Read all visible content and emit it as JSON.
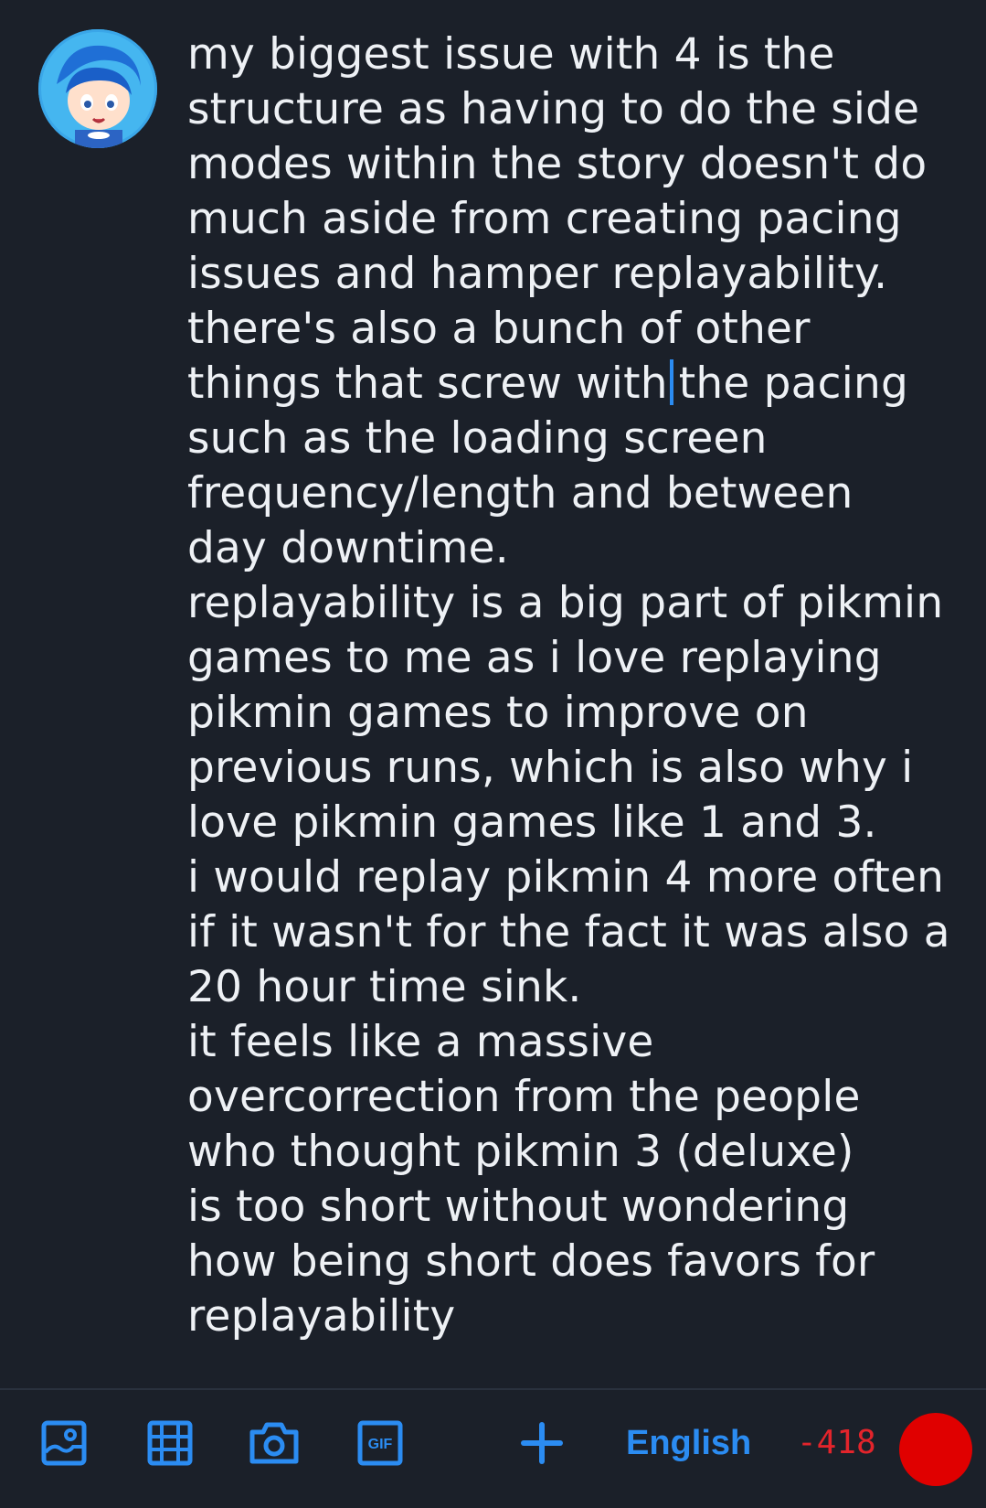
{
  "post": {
    "lines": [
      "my biggest issue with 4 is the",
      "structure as having to do the side",
      "modes within the story doesn't do",
      "much aside from creating pacing",
      "issues and hamper replayability.",
      "there's also a bunch of other",
      "things that screw with",
      "the pacing",
      "such as the loading screen",
      "frequency/length and between",
      "day downtime.",
      "replayability is a big part of pikmin",
      "games to me as i love replaying",
      "pikmin games to improve on",
      "previous runs, which is also why i",
      "love pikmin games like 1 and 3.",
      "i would replay pikmin 4 more often",
      "if it wasn't for the fact it was also a",
      "20 hour time sink.",
      "it feels like a massive",
      "overcorrection from the people",
      "who thought pikmin 3 (deluxe)",
      "is too short without wondering",
      "how being short does favors for",
      "replayability"
    ]
  },
  "toolbar": {
    "icons": [
      "image-icon",
      "video-icon",
      "camera-icon",
      "gif-icon",
      "plus-icon"
    ],
    "gif_text": "GIF",
    "language": "English",
    "char_count": "-418"
  },
  "colors": {
    "background": "#1b2029",
    "text": "#eef1f5",
    "accent": "#2b8cf2",
    "error": "#e3242b",
    "progress": "#e00000"
  }
}
